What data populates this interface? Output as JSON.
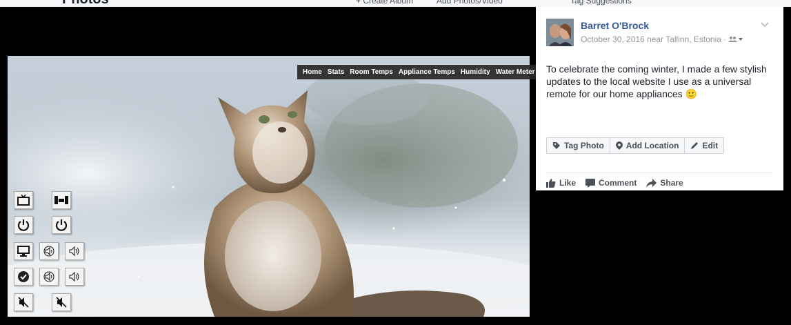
{
  "background_header": {
    "title": "Photos",
    "create_album": "+ Create Album",
    "add_photos": "Add Photos/Video",
    "tag_suggestions": "Tag Suggestions"
  },
  "photo_nav": {
    "items": [
      "Home",
      "Stats",
      "Room Temps",
      "Appliance Temps",
      "Humidity",
      "Water Meter"
    ]
  },
  "remote_buttons": [
    {
      "name": "tv-icon"
    },
    {
      "name": "stereo-icon"
    },
    {
      "name": "power-icon"
    },
    {
      "name": "power-icon"
    },
    {
      "name": "monitor-icon"
    },
    {
      "name": "volume-down-icon"
    },
    {
      "name": "volume-up-icon"
    },
    {
      "name": "check-icon"
    },
    {
      "name": "volume-down-icon"
    },
    {
      "name": "volume-up-icon"
    },
    {
      "name": "mute-icon"
    },
    {
      "name": "mute-icon"
    }
  ],
  "post": {
    "author": "Barret O'Brock",
    "date_location": "October 30, 2016 near Tallinn, Estonia",
    "separator": "·",
    "audience_icon": "friends-icon",
    "text": "To celebrate the coming winter, I made a few stylish updates to the local website I use as a universal remote for our home appliances 🙂",
    "actions": {
      "tag_photo": "Tag Photo",
      "add_location": "Add Location",
      "edit": "Edit"
    },
    "ufi": {
      "like": "Like",
      "comment": "Comment",
      "share": "Share"
    }
  },
  "colors": {
    "link_blue": "#365899",
    "meta_gray": "#90949c",
    "text": "#1d2129"
  }
}
